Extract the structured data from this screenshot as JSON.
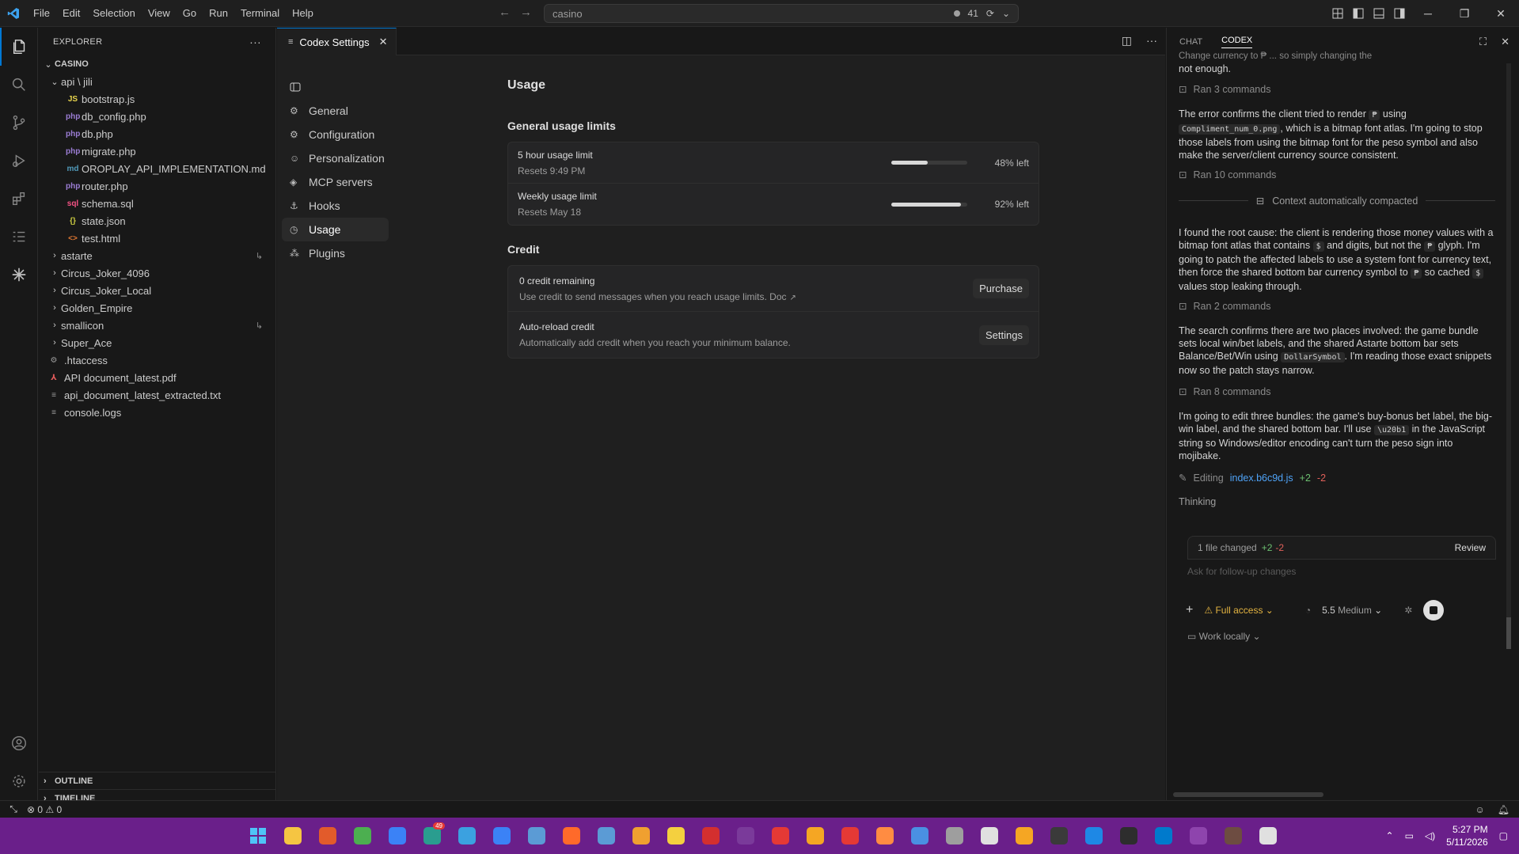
{
  "titlebar": {
    "menu": [
      "File",
      "Edit",
      "Selection",
      "View",
      "Go",
      "Run",
      "Terminal",
      "Help"
    ],
    "search_text": "casino",
    "notifications_count": "41"
  },
  "explorer": {
    "header": "EXPLORER",
    "root": "CASINO",
    "folder_open": "api \\ jili",
    "files": [
      {
        "name": "bootstrap.js",
        "icon": "JS",
        "color": "#e8d44d"
      },
      {
        "name": "db_config.php",
        "icon": "php",
        "color": "#9b7dd4"
      },
      {
        "name": "db.php",
        "icon": "php",
        "color": "#9b7dd4"
      },
      {
        "name": "migrate.php",
        "icon": "php",
        "color": "#9b7dd4"
      },
      {
        "name": "OROPLAY_API_IMPLEMENTATION.md",
        "icon": "md",
        "color": "#519aba"
      },
      {
        "name": "router.php",
        "icon": "php",
        "color": "#9b7dd4"
      },
      {
        "name": "schema.sql",
        "icon": "sql",
        "color": "#f55385"
      },
      {
        "name": "state.json",
        "icon": "{}",
        "color": "#cbcb41"
      },
      {
        "name": "test.html",
        "icon": "<>",
        "color": "#e37933"
      }
    ],
    "folders": [
      "astarte",
      "Circus_Joker_4096",
      "Circus_Joker_Local",
      "Golden_Empire",
      "smallicon",
      "Super_Ace"
    ],
    "root_files": [
      {
        "name": ".htaccess",
        "icon": "gear"
      },
      {
        "name": "API document_latest.pdf",
        "icon": "pdf"
      },
      {
        "name": "api_document_latest_extracted.txt",
        "icon": "txt"
      },
      {
        "name": "console.logs",
        "icon": "txt"
      }
    ],
    "outline": "OUTLINE",
    "timeline": "TIMELINE"
  },
  "editor": {
    "tab_title": "Codex Settings",
    "nav": [
      "General",
      "Configuration",
      "Personalization",
      "MCP servers",
      "Hooks",
      "Usage",
      "Plugins"
    ],
    "active_nav": "Usage",
    "page_title": "Usage",
    "usage_section": "General usage limits",
    "limits": [
      {
        "title": "5 hour usage limit",
        "reset": "Resets 9:49 PM",
        "left_label": "48% left",
        "fraction_used": 0.48
      },
      {
        "title": "Weekly usage limit",
        "reset": "Resets May 18",
        "left_label": "92% left",
        "fraction_used": 0.92
      }
    ],
    "credit_section": "Credit",
    "credit_rows": [
      {
        "title": "0 credit remaining",
        "desc": "Use credit to send messages when you reach usage limits. Doc",
        "button": "Purchase"
      },
      {
        "title": "Auto-reload credit",
        "desc": "Automatically add credit when you reach your minimum balance.",
        "button": "Settings"
      }
    ]
  },
  "chat": {
    "tabs": [
      "CHAT",
      "CODEX"
    ],
    "active_tab": "CODEX",
    "top_line": "Change currency to ₱ ... so simply changing the",
    "top_line2": "not enough.",
    "ran1": "Ran 3 commands",
    "msg1_a": "The error confirms the client tried to render",
    "msg1_code1": "₱",
    "msg1_b": "using",
    "msg1_code2": "Compliment_num_0.png",
    "msg1_c": ", which is a bitmap font atlas. I'm going to stop those labels from using the bitmap font for the peso symbol and also make the server/client currency source consistent.",
    "ran2": "Ran 10 commands",
    "compacted": "Context automatically compacted",
    "msg2_a": "I found the root cause: the client is rendering those money values with a bitmap font atlas that contains",
    "msg2_code1": "$",
    "msg2_b": "and digits, but not the",
    "msg2_code2": "₱",
    "msg2_c": "glyph. I'm going to patch the affected labels to use a system font for currency text, then force the shared bottom bar currency symbol to",
    "msg2_code3": "₱",
    "msg2_d": "so cached",
    "msg2_code4": "$",
    "msg2_e": "values stop leaking through.",
    "ran3": "Ran 2 commands",
    "msg3_a": "The search confirms there are two places involved: the game bundle sets local win/bet labels, and the shared Astarte bottom bar sets Balance/Bet/Win using",
    "msg3_code": "DollarSymbol",
    "msg3_b": ". I'm reading those exact snippets now so the patch stays narrow.",
    "ran4": "Ran 8 commands",
    "msg4_a": "I'm going to edit three bundles: the game's buy-bonus bet label, the big-win label, and the shared bottom bar. I'll use",
    "msg4_code": "\\u20b1",
    "msg4_b": "in the JavaScript string so Windows/editor encoding can't turn the peso sign into mojibake.",
    "editing_label": "Editing",
    "editing_file": "index.b6c9d.js",
    "editing_add": "+2",
    "editing_del": "-2",
    "thinking": "Thinking",
    "files_changed": "1 file changed",
    "fc_add": "+2",
    "fc_del": "-2",
    "review": "Review",
    "input_placeholder": "Ask for follow-up changes",
    "access": "Full access",
    "model": "5.5",
    "effort": "Medium",
    "work_mode": "Work locally"
  },
  "status": {
    "errors": "0",
    "warnings": "0"
  },
  "taskbar": {
    "badge": "49",
    "time": "5:27 PM",
    "date": "5/11/2026",
    "apps": [
      "#f5c542",
      "#e25b2b",
      "#4caf50",
      "#3b82f6",
      "#2a9d8f",
      "#3ba1e0",
      "#3b82f6",
      "#5b9bd5",
      "#ff6a2a",
      "#5b9bd5",
      "#f0a030",
      "#f4d03f",
      "#d32f2f",
      "#7a3a9a",
      "#e53935",
      "#f5a623",
      "#e53935",
      "#ff8c42",
      "#4a90e2",
      "#9e9e9e",
      "#e0e0e0",
      "#f5a623",
      "#3a3a3a",
      "#1e88e5",
      "#2d2d2d",
      "#007acc",
      "#8e44ad",
      "#6d4c41",
      "#e0e0e0"
    ]
  }
}
